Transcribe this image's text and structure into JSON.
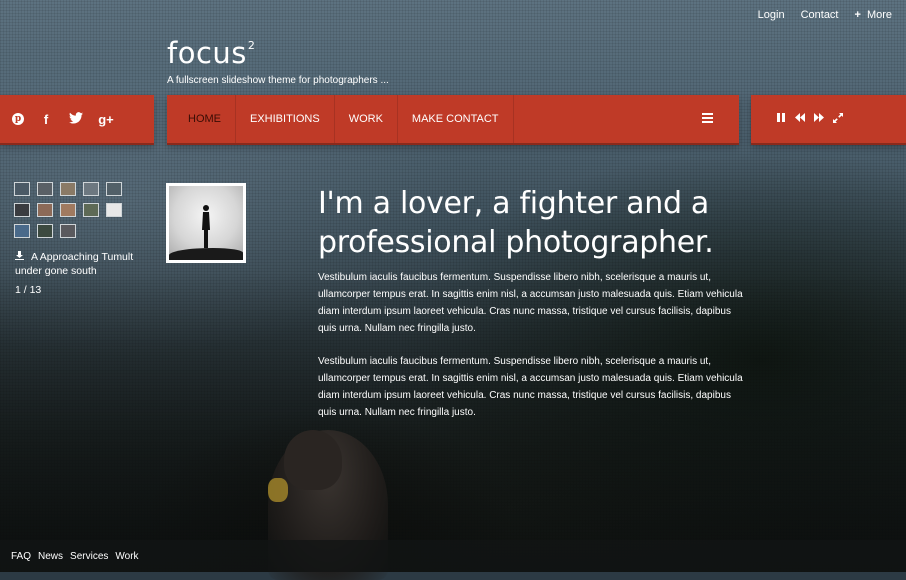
{
  "toplinks": {
    "login": "Login",
    "contact": "Contact",
    "more_plus": "+",
    "more": "More"
  },
  "logo": {
    "text": "focus",
    "superscript": "2",
    "tagline": "A fullscreen slideshow theme for photographers  ..."
  },
  "social": [
    {
      "icon": "pinterest-icon",
      "glyph": "p"
    },
    {
      "icon": "facebook-icon",
      "glyph": "f"
    },
    {
      "icon": "twitter-icon",
      "glyph": "t"
    },
    {
      "icon": "google-plus-icon",
      "glyph": "g+"
    }
  ],
  "nav": {
    "items": [
      {
        "label": "HOME",
        "active": true
      },
      {
        "label": "EXHIBITIONS",
        "active": false
      },
      {
        "label": "WORK",
        "active": false
      },
      {
        "label": "MAKE CONTACT",
        "active": false
      }
    ]
  },
  "controls": {
    "pause": "❚❚",
    "prev": "◀◀",
    "next": "▶▶",
    "fullscreen": "⤢"
  },
  "thumbnails": [
    "#4b5a66",
    "#5a6066",
    "#8a7a66",
    "#6d7880",
    "#526068",
    "#3a3c40",
    "#8c6a58",
    "#a07a60",
    "#5e6a56",
    "#e8e8e8",
    "#4a6a8a",
    "#3c4a40",
    "#5a5a5e"
  ],
  "slide": {
    "caption": "A Approaching Tumult under gone south",
    "counter": "1 / 13"
  },
  "content": {
    "headline": "I'm a lover, a fighter and a professional photographer.",
    "paragraph1": "Vestibulum iaculis faucibus fermentum. Suspendisse libero nibh, scelerisque a mauris ut, ullamcorper tempus erat. In sagittis enim nisl, a accumsan justo malesuada quis. Etiam vehicula diam interdum ipsum laoreet vehicula. Cras nunc massa, tristique vel cursus facilisis, dapibus quis urna. Nullam nec fringilla justo.",
    "paragraph2": "Vestibulum iaculis faucibus fermentum. Suspendisse libero nibh, scelerisque a mauris ut, ullamcorper tempus erat. In sagittis enim nisl, a accumsan justo malesuada quis. Etiam vehicula diam interdum ipsum laoreet vehicula. Cras nunc massa, tristique vel cursus facilisis, dapibus quis urna. Nullam nec fringilla justo."
  },
  "footer": {
    "links": [
      "FAQ",
      "News",
      "Services",
      "Work"
    ]
  },
  "colors": {
    "accent": "#bf3a27",
    "nav_active_text": "#3a0d05"
  }
}
